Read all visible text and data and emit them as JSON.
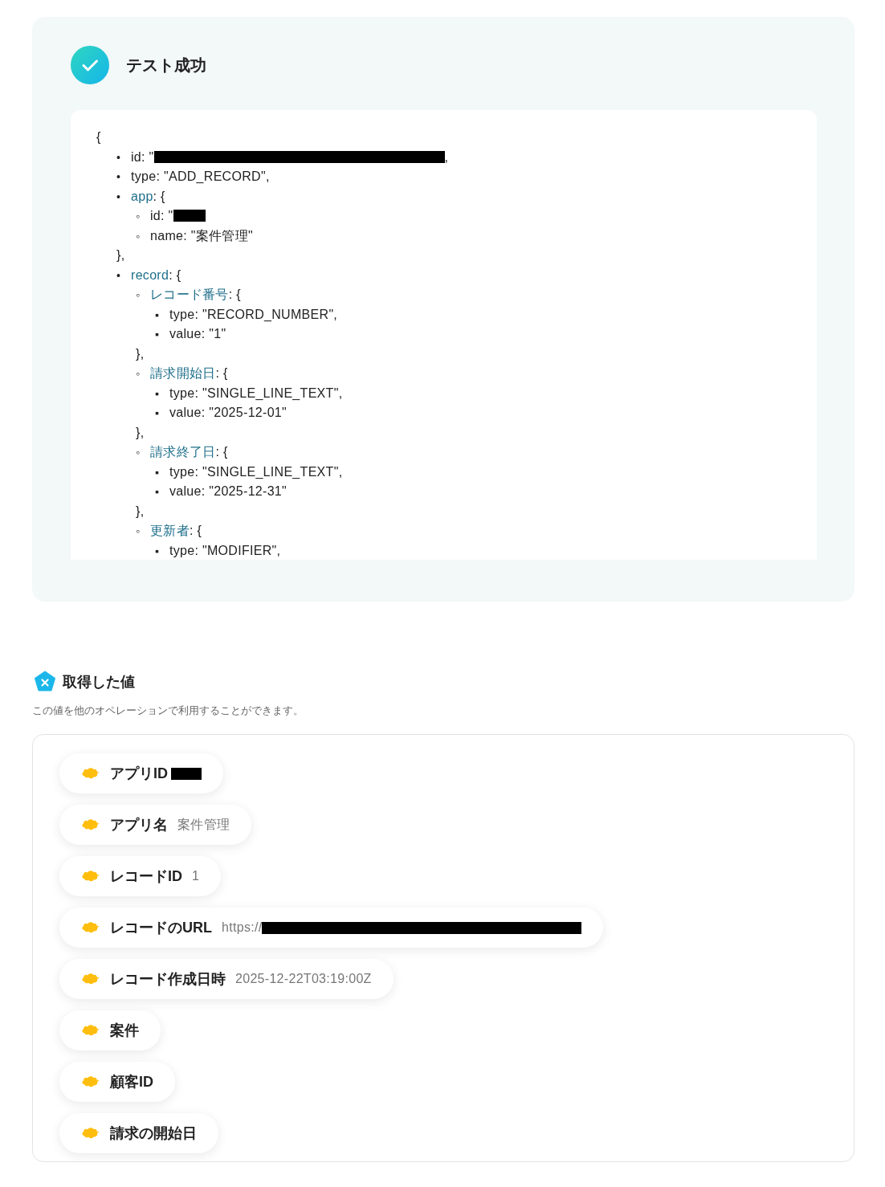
{
  "result": {
    "title": "テスト成功",
    "code": {
      "open": "{",
      "items": [
        {
          "marker": "•",
          "text": "id: \"",
          "redacted": true,
          "tail": ","
        },
        {
          "marker": "•",
          "text": "type: \"ADD_RECORD\","
        },
        {
          "marker": "•",
          "key": "app",
          "text": ": {",
          "close": "},",
          "children": [
            {
              "marker": "◦",
              "text": "id: \"",
              "redacted": true
            },
            {
              "marker": "◦",
              "text": "name: \"案件管理\""
            }
          ]
        },
        {
          "marker": "•",
          "key": "record",
          "text": ": {",
          "children": [
            {
              "marker": "◦",
              "key": "レコード番号",
              "text": ": {",
              "close": "},",
              "children": [
                {
                  "marker": "▪",
                  "text": "type: \"RECORD_NUMBER\","
                },
                {
                  "marker": "▪",
                  "text": "value: \"1\""
                }
              ]
            },
            {
              "marker": "◦",
              "key": "請求開始日",
              "text": ": {",
              "close": "},",
              "children": [
                {
                  "marker": "▪",
                  "text": "type: \"SINGLE_LINE_TEXT\","
                },
                {
                  "marker": "▪",
                  "text": "value: \"2025-12-01\""
                }
              ]
            },
            {
              "marker": "◦",
              "key": "請求終了日",
              "text": ": {",
              "close": "},",
              "children": [
                {
                  "marker": "▪",
                  "text": "type: \"SINGLE_LINE_TEXT\","
                },
                {
                  "marker": "▪",
                  "text": "value: \"2025-12-31\""
                }
              ]
            },
            {
              "marker": "◦",
              "key": "更新者",
              "text": ": {",
              "children": [
                {
                  "marker": "▪",
                  "text": "type: \"MODIFIER\","
                }
              ]
            }
          ]
        }
      ]
    }
  },
  "values": {
    "title": "取得した値",
    "description": "この値を他のオペレーションで利用することができます。",
    "items": [
      {
        "label": "アプリID",
        "redacted": true
      },
      {
        "label": "アプリ名",
        "value": "案件管理"
      },
      {
        "label": "レコードID",
        "value": "1"
      },
      {
        "label": "レコードのURL",
        "value": "https://",
        "redacted": true,
        "wide": true
      },
      {
        "label": "レコード作成日時",
        "value": "2025-12-22T03:19:00Z"
      },
      {
        "label": "案件"
      },
      {
        "label": "顧客ID"
      },
      {
        "label": "請求の開始日"
      }
    ]
  }
}
